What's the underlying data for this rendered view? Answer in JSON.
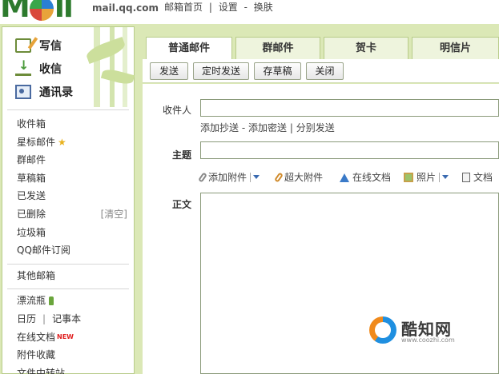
{
  "header": {
    "domain": "mail.qq.com",
    "links": [
      "邮箱首页",
      "|",
      "设置",
      "-",
      "换肤"
    ]
  },
  "sidebar": {
    "main": [
      {
        "label": "写信",
        "icon": "compose-icon"
      },
      {
        "label": "收信",
        "icon": "inbox-icon"
      },
      {
        "label": "通讯录",
        "icon": "contacts-icon"
      }
    ],
    "folders": [
      {
        "label": "收件箱"
      },
      {
        "label": "星标邮件"
      },
      {
        "label": "群邮件"
      },
      {
        "label": "草稿箱"
      },
      {
        "label": "已发送"
      },
      {
        "label": "已删除",
        "action": "[清空]"
      },
      {
        "label": "垃圾箱"
      },
      {
        "label": "QQ邮件订阅"
      }
    ],
    "other": [
      {
        "label": "其他邮箱"
      }
    ],
    "apps": [
      {
        "label": "漂流瓶"
      },
      {
        "label": "日历",
        "extra": "记事本"
      },
      {
        "label": "在线文档",
        "badge": "NEW"
      },
      {
        "label": "附件收藏"
      },
      {
        "label": "文件中转站"
      }
    ]
  },
  "tabs": [
    "普通邮件",
    "群邮件",
    "贺卡",
    "明信片"
  ],
  "toolbar": {
    "send": "发送",
    "scheduled": "定时发送",
    "save_draft": "存草稿",
    "close": "关闭"
  },
  "form": {
    "to_label": "收件人",
    "to_value": "",
    "cc_links": [
      "添加抄送",
      "-",
      "添加密送",
      "|",
      "分别发送"
    ],
    "subject_label": "主题",
    "subject_value": "",
    "attach": {
      "add_attachment": "添加附件",
      "big_attachment": "超大附件",
      "online_doc": "在线文档",
      "photo": "照片",
      "doc": "文档"
    },
    "body_label": "正文"
  },
  "watermark": {
    "name": "酷知网",
    "url": "www.coozhi.com"
  }
}
